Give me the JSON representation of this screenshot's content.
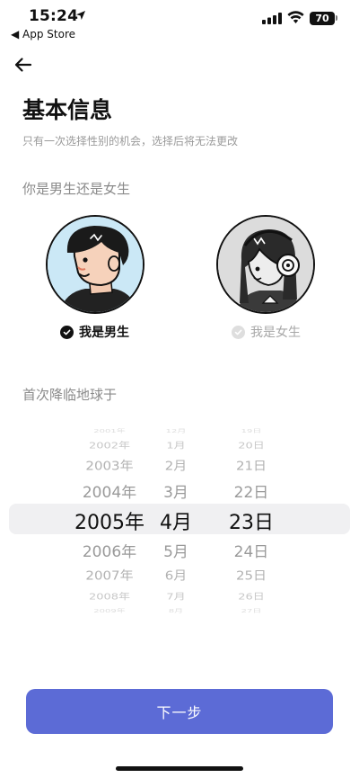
{
  "status_bar": {
    "time": "15:24",
    "back_app": "◀ App Store",
    "battery": "70"
  },
  "page": {
    "title": "基本信息",
    "subtitle": "只有一次选择性别的机会，选择后将无法更改",
    "gender_question": "你是男生还是女生",
    "birth_question": "首次降临地球于"
  },
  "gender": {
    "selected": "male",
    "male_label": "我是男生",
    "female_label": "我是女生"
  },
  "picker": {
    "years": [
      "2001年",
      "2002年",
      "2003年",
      "2004年",
      "2005年",
      "2006年",
      "2007年",
      "2008年",
      "2009年"
    ],
    "months": [
      "12月",
      "1月",
      "2月",
      "3月",
      "4月",
      "5月",
      "6月",
      "7月",
      "8月"
    ],
    "days": [
      "19日",
      "20日",
      "21日",
      "22日",
      "23日",
      "24日",
      "25日",
      "26日",
      "27日"
    ],
    "selected_index": 4,
    "selected_year": "2005年",
    "selected_month": "4月",
    "selected_day": "23日"
  },
  "footer": {
    "next_label": "下一步"
  },
  "colors": {
    "accent": "#5c6bd6",
    "male_bg": "#cbe8f6",
    "female_bg": "#dcdcdc",
    "highlight": "#f0f0f2"
  }
}
